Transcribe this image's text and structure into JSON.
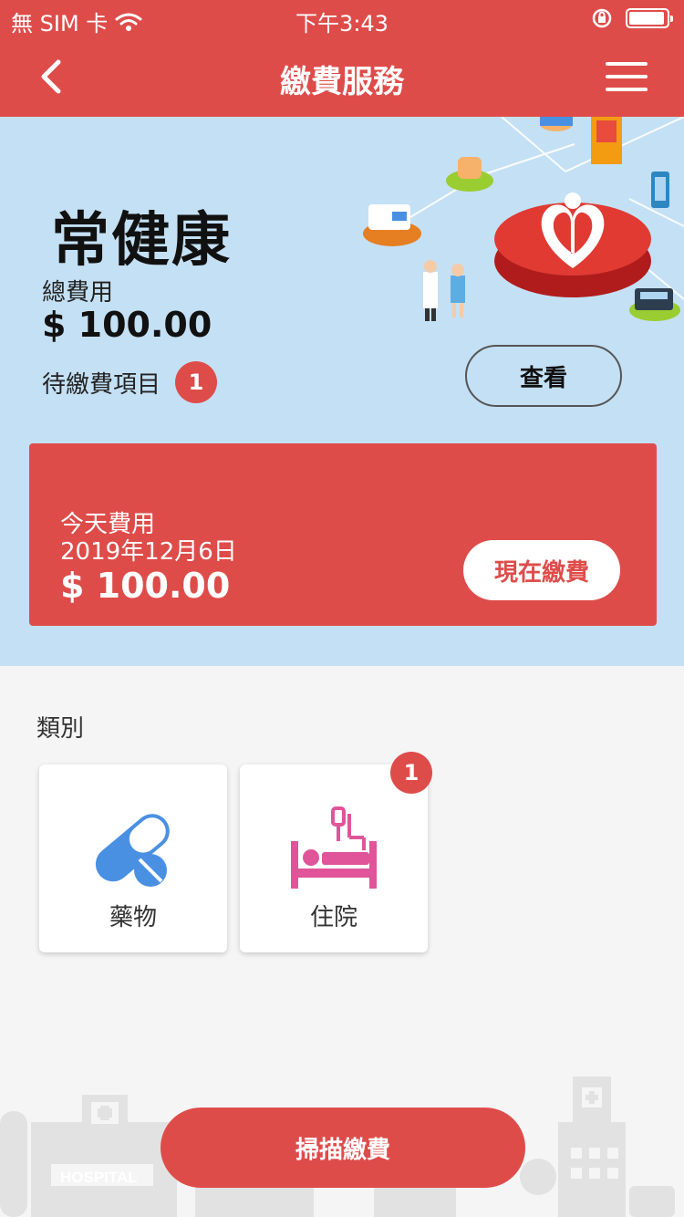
{
  "status_bar": {
    "carrier": "無 SIM 卡",
    "time": "下午3:43",
    "battery_level": 0.95
  },
  "nav": {
    "title": "繳費服務"
  },
  "hero": {
    "brand": "常健康",
    "total_label": "總費用",
    "total_value": "$ 100.00",
    "pending_label": "待繳費項目",
    "pending_count": "1",
    "view_button": "查看"
  },
  "today": {
    "label": "今天費用",
    "date": "2019年12月6日",
    "amount": "$ 100.00",
    "pay_button": "現在繳費"
  },
  "categories": {
    "title": "類別",
    "items": [
      {
        "label": "藥物",
        "icon": "pill-icon",
        "color": "#4a90e2"
      },
      {
        "label": "住院",
        "icon": "hospital-bed-icon",
        "color": "#e0559a",
        "badge": "1"
      }
    ]
  },
  "scan_button": "掃描繳費",
  "colors": {
    "primary": "#de4c4a",
    "hero_bg": "#c4e0f4"
  }
}
